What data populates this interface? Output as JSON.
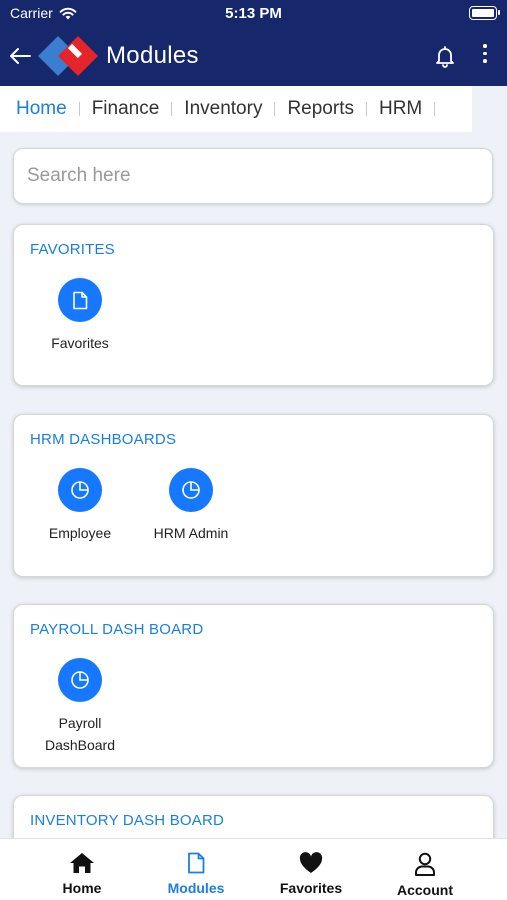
{
  "status_bar": {
    "carrier": "Carrier",
    "time": "5:13 PM"
  },
  "app_bar": {
    "title": "Modules"
  },
  "tabs": [
    {
      "label": "Home",
      "active": true
    },
    {
      "label": "Finance"
    },
    {
      "label": "Inventory"
    },
    {
      "label": "Reports"
    },
    {
      "label": "HRM"
    }
  ],
  "search": {
    "placeholder": "Search here",
    "value": ""
  },
  "sections": [
    {
      "title": "FAVORITES",
      "items": [
        {
          "label": "Favorites",
          "icon": "document-icon"
        }
      ]
    },
    {
      "title": "HRM DASHBOARDS",
      "items": [
        {
          "label": "Employee",
          "icon": "pie-chart-icon"
        },
        {
          "label": "HRM Admin",
          "icon": "pie-chart-icon"
        }
      ]
    },
    {
      "title": "PAYROLL DASH BOARD",
      "items": [
        {
          "label": "Payroll\nDashBoard",
          "icon": "pie-chart-icon"
        }
      ]
    },
    {
      "title": "INVENTORY DASH BOARD",
      "items": []
    }
  ],
  "bottom_nav": [
    {
      "label": "Home",
      "icon": "home-icon"
    },
    {
      "label": "Modules",
      "icon": "document-icon",
      "active": true
    },
    {
      "label": "Favorites",
      "icon": "heart-icon"
    },
    {
      "label": "Account",
      "icon": "user-icon"
    }
  ],
  "colors": {
    "header": "#16276b",
    "accent": "#1a7fe0",
    "module_circle": "#1677ff",
    "logo_red": "#e5252a",
    "logo_blue": "#3a7fcf"
  }
}
